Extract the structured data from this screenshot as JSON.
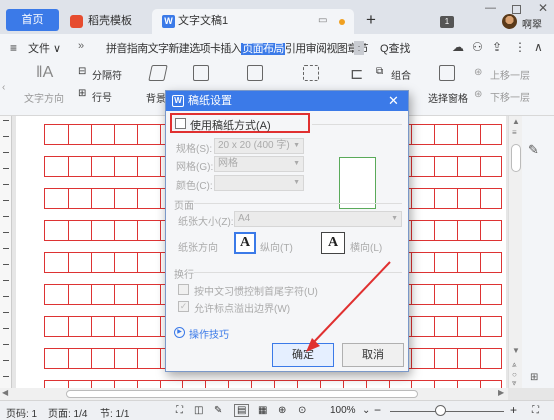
{
  "titlebar": {
    "home_tab": "首页",
    "templates_tab": "稻壳模板",
    "doc_tab": "文字文稿1",
    "add_tab": "+",
    "badge": "1",
    "username": "啊翠"
  },
  "menubar": {
    "menu_icon": "≡",
    "file": "文件 ∨",
    "more": "»",
    "strip_before": "拼音指南文字新建选项卡插入",
    "strip_active": "页面布局",
    "strip_after": "引用审阅视图章节",
    "scroll": ":",
    "search": "Q查找"
  },
  "ribbon": {
    "text_direction": "文字方向",
    "columns": "分隔符",
    "line_number": "行号",
    "background": "背景",
    "group": "组合",
    "select_pane": "选择窗格",
    "move_up": "上移一层",
    "move_down": "下移一层"
  },
  "dialog": {
    "title": "稿纸设置",
    "use_grid_label": "使用稿纸方式(A)",
    "spec_label": "规格(S):",
    "spec_value": "20 x 20 (400 字)",
    "grid_label": "网格(G):",
    "grid_value": "网格",
    "color_label": "颜色(C):",
    "page_section": "页面",
    "paper_size_label": "纸张大小(Z):",
    "paper_size_value": "A4",
    "orientation_label": "纸张方向",
    "portrait": "纵向(T)",
    "landscape": "横向(L)",
    "orient_glyph": "A",
    "wrap_section": "换行",
    "opt_punct": "按中文习惯控制首尾字符(U)",
    "opt_overflow": "允许标点溢出边界(W)",
    "tips": "操作技巧",
    "ok": "确定",
    "cancel": "取消"
  },
  "statusbar": {
    "page_num": "页码: 1",
    "page_of": "页面: 1/4",
    "section": "节: 1/1",
    "zoom": "100%",
    "zoom_minus": "−",
    "zoom_plus": "+"
  },
  "colors": {
    "accent": "#3b7ae8",
    "grid": "#dd3333",
    "highlight": "#e03030"
  }
}
